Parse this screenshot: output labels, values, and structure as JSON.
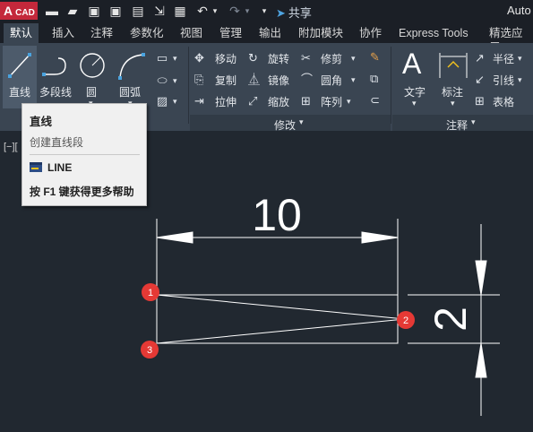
{
  "app": {
    "logo_big": "A",
    "logo_small": "CAD",
    "title": "Auto"
  },
  "quick_access": {
    "share_label": "共享",
    "icons": [
      "new-icon",
      "open-icon",
      "save-icon",
      "save-as-icon",
      "plot-icon",
      "import-icon",
      "print-icon",
      "undo-icon",
      "redo-icon",
      "dropdown-icon"
    ]
  },
  "tabs": [
    "默认",
    "插入",
    "注释",
    "参数化",
    "视图",
    "管理",
    "输出",
    "附加模块",
    "协作",
    "Express Tools",
    "精选应用"
  ],
  "active_tab": "默认",
  "ribbon": {
    "draw": {
      "line": "直线",
      "polyline": "多段线",
      "circle": "圆",
      "arc": "圆弧"
    },
    "modify": {
      "title": "修改",
      "move": "移动",
      "rotate": "旋转",
      "trim": "修剪",
      "copy": "复制",
      "mirror": "镜像",
      "fillet": "圆角",
      "stretch": "拉伸",
      "scale": "缩放",
      "array": "阵列"
    },
    "annotation": {
      "title": "注释",
      "text": "文字",
      "dimension": "标注",
      "radius": "半径",
      "leader": "引线",
      "table": "表格"
    }
  },
  "tooltip": {
    "title": "直线",
    "description": "创建直线段",
    "command": "LINE",
    "help": "按 F1 键获得更多帮助"
  },
  "viewport_label": "[−][",
  "drawing": {
    "dim_horizontal": "10",
    "dim_vertical": "2",
    "markers": [
      "1",
      "2",
      "3"
    ],
    "colors": {
      "marker": "#e53935",
      "line": "#ffffff",
      "background": "#212830"
    }
  }
}
